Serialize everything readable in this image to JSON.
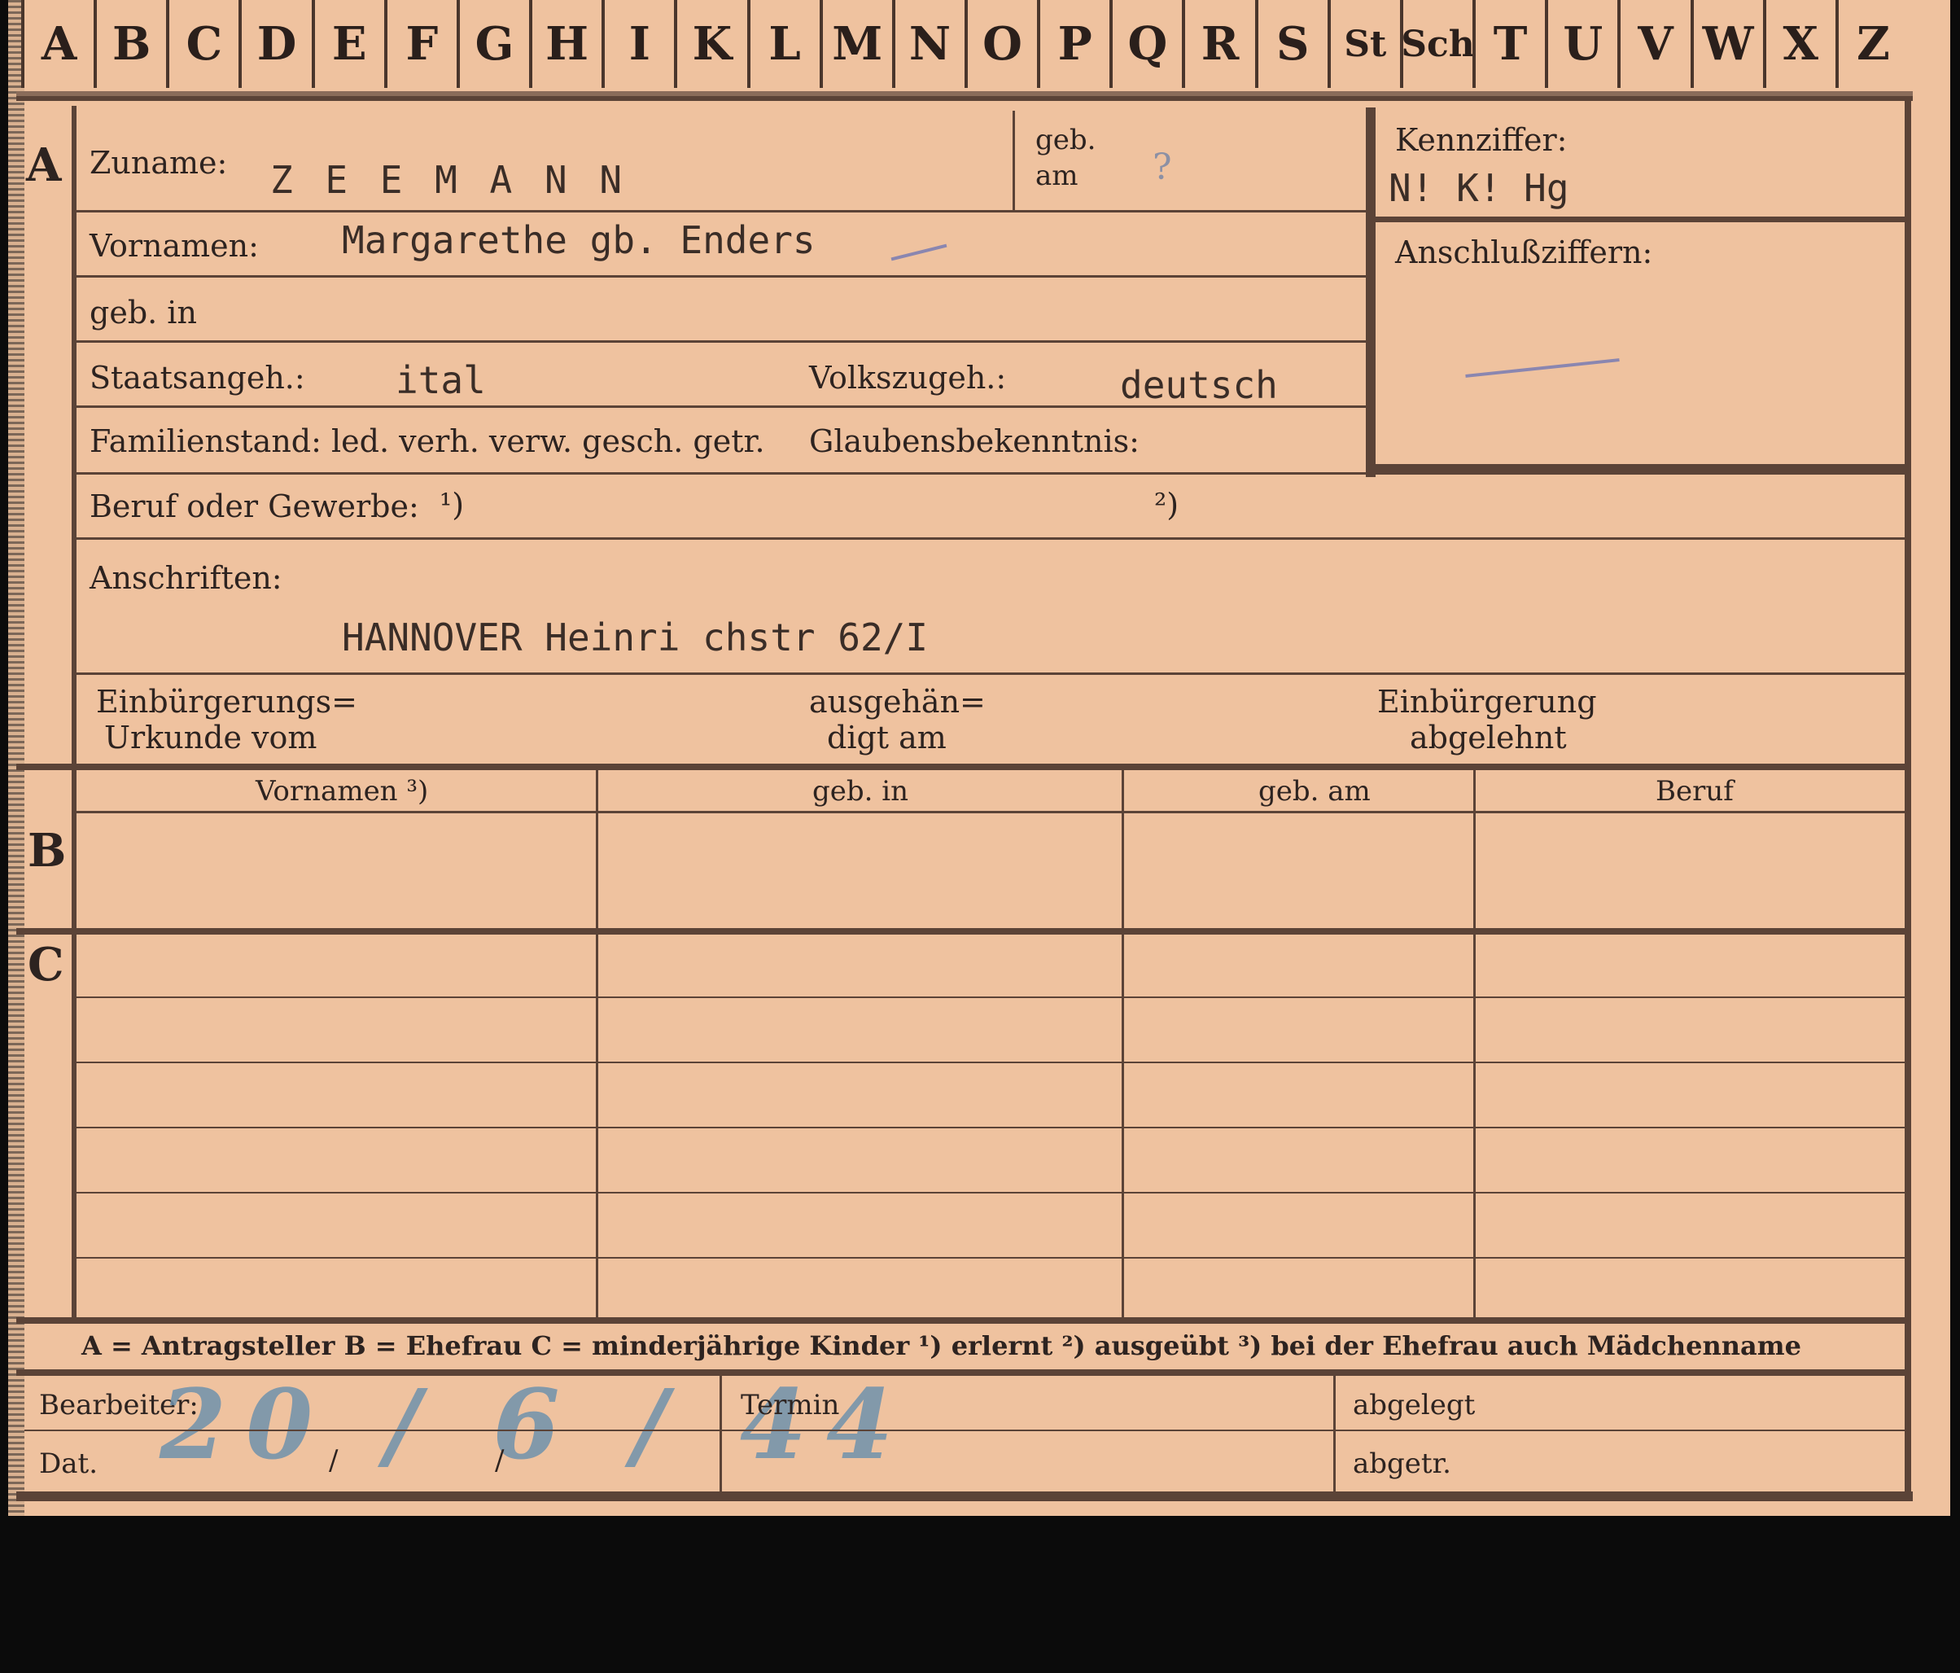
{
  "tabs": [
    "A",
    "B",
    "C",
    "D",
    "E",
    "F",
    "G",
    "H",
    "I",
    "K",
    "L",
    "M",
    "N",
    "O",
    "P",
    "Q",
    "R",
    "S",
    "St",
    "Sch",
    "T",
    "U",
    "V",
    "W",
    "X",
    "Z"
  ],
  "section_a": {
    "marker": "A",
    "surname_label": "Zuname:",
    "surname_value": "Z E E M A N N",
    "born_label_1": "geb.",
    "born_label_2": "am",
    "born_value": "?",
    "code_label": "Kennziffer:",
    "code_value": "N! K!   Hg",
    "link_label": "Anschlußziffern:",
    "firstname_label": "Vornamen:",
    "firstname_value": "Margarethe gb. Enders",
    "birthplace_label": "geb. in",
    "citizenship_label": "Staatsangeh.:",
    "citizenship_value": "ital",
    "ethnicity_label": "Volkszugeh.:",
    "ethnicity_value": "deutsch",
    "family_label": "Familienstand: led. verh. verw. gesch. getr.",
    "religion_label": "Glaubensbekenntnis:",
    "occupation_label": "Beruf oder Gewerbe:",
    "occupation_note1": "¹)",
    "occupation_note2": "²)",
    "address_label": "Anschriften:",
    "address_value": "HANNOVER Heinri chstr 62/I",
    "naturalization_label_1": "Einbürgerungs=",
    "naturalization_label_2": "Urkunde vom",
    "handed_label_1": "ausgehän=",
    "handed_label_2": "digt am",
    "rejected_label_1": "Einbürgerung",
    "rejected_label_2": "abgelehnt"
  },
  "section_b": {
    "marker": "B",
    "columns": [
      "Vornamen ³)",
      "geb. in",
      "geb. am",
      "Beruf"
    ]
  },
  "section_c": {
    "marker": "C"
  },
  "legend": "A = Antragsteller   B = Ehefrau   C = minderjährige Kinder   ¹) erlernt   ²) ausgeübt   ³) bei der Ehefrau auch Mädchenname",
  "footer": {
    "clerk_label": "Bearbeiter:",
    "date_label": "Dat.",
    "date_value": "20 / 6 / 44",
    "date_slash": "/",
    "termin_label": "Termin",
    "filed_label": "abgelegt",
    "removed_label": "abgetr."
  },
  "colors": {
    "card": "#efc29f",
    "ink": "#2d2320",
    "rule": "#5b4337",
    "pencil": "#6f92ad"
  }
}
